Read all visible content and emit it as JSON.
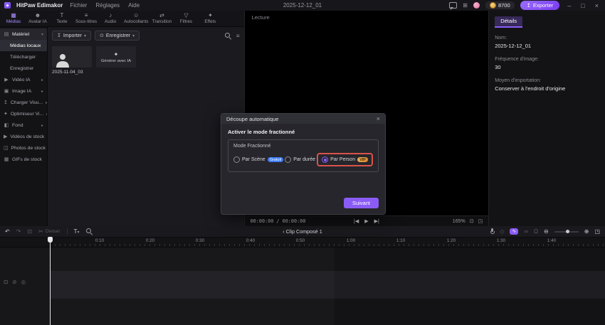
{
  "colors": {
    "accent": "#8b5cf6",
    "highlight_red": "#d9534a",
    "badge_blue": "#3d7bf5",
    "badge_orange": "#e09a3e"
  },
  "titlebar": {
    "app_name": "HitPaw Edimakor",
    "menus": [
      "Fichier",
      "Réglages",
      "Aide"
    ],
    "document_title": "2025-12-12_01",
    "coin_count": "8700",
    "export_label": "Exporter"
  },
  "tabs": [
    {
      "label": "Médias"
    },
    {
      "label": "Avatar IA"
    },
    {
      "label": "Texte"
    },
    {
      "label": "Sous-titres"
    },
    {
      "label": "Audio"
    },
    {
      "label": "Autocollants"
    },
    {
      "label": "Transition"
    },
    {
      "label": "Filtres"
    },
    {
      "label": "Effets"
    }
  ],
  "sidebar": {
    "material": "Matériel",
    "material_items": [
      "Médias locaux",
      "Télécharger",
      "Enregistrer"
    ],
    "sections": [
      "Vidéo IA",
      "Image IA",
      "Charger Visu...",
      "Optimiseur Vi...",
      "Fond"
    ],
    "stock": [
      "Vidéos de stock",
      "Photos de stock",
      "GIFs de stock"
    ]
  },
  "media": {
    "import_label": "Importer",
    "record_label": "Enregistrer",
    "clip_name": "2025-11-04_03",
    "generate_label": "Générer avec IA"
  },
  "preview": {
    "label": "Lecture",
    "timecode": "00:00:00 / 00:00:00",
    "zoom_level": "165%"
  },
  "details": {
    "tab_label": "Détails",
    "name_label": "Nom:",
    "name_value": "2025-12-12_01",
    "fps_label": "Fréquence d'image:",
    "fps_value": "30",
    "import_label": "Moyen d'importation:",
    "import_value": "Conserver à l'endroit d'origine"
  },
  "modal": {
    "title": "Découpe automatique",
    "close": "×",
    "subtitle": "Activer le mode fractionné",
    "group_label": "Mode Fractionné",
    "options": [
      {
        "label": "Par Scène",
        "badge": "Gratuit"
      },
      {
        "label": "Par durée",
        "badge": ""
      },
      {
        "label": "Par Person",
        "badge": "VIP"
      }
    ],
    "next_label": "Suivant"
  },
  "timeline": {
    "divide_label": "Diviser",
    "text_tool": "T",
    "clip_label": "Clip Composé 1",
    "ruler": [
      "0",
      "0:10",
      "0:20",
      "0:30",
      "0:40",
      "0:50",
      "1:00",
      "1:10",
      "1:20",
      "1:30",
      "1:40"
    ]
  },
  "icons": {
    "logo": "◆",
    "apps": "⊞",
    "export_arrow": "↥",
    "minimize": "–",
    "maximize": "□",
    "close": "×",
    "tab_media": "▦",
    "tab_avatar": "☻",
    "tab_text": "T",
    "tab_subtitles": "≡",
    "tab_audio": "♪",
    "tab_stickers": "☺",
    "tab_transition": "⇄",
    "tab_filters": "▽",
    "tab_effects": "✦",
    "material": "▤",
    "video_ai": "▶",
    "image_ai": "▣",
    "upload": "↥",
    "optimizer": "✦",
    "background": "◧",
    "stock_video": "▶",
    "stock_photo": "◫",
    "stock_gif": "▦",
    "import": "↧",
    "record": "⊙",
    "caret_down": "▾",
    "caret_right": "▸",
    "list_view": "≡",
    "wand": "✦",
    "prev": "|◀",
    "play": "▶",
    "next": "▶|",
    "ratio": "⊡",
    "fit": "◳",
    "undo": "↶",
    "redo": "↷",
    "snapshot": "⊡",
    "scissors": "✂",
    "zoom_out": "⊖",
    "zoom_in": "⊕",
    "back": "‹",
    "wave": "∿",
    "magnet": "Ω",
    "link": "∞",
    "keyframe": "◇",
    "track_a": "⊡",
    "track_b": "⊘",
    "track_c": "◎",
    "modal_close": "×"
  }
}
